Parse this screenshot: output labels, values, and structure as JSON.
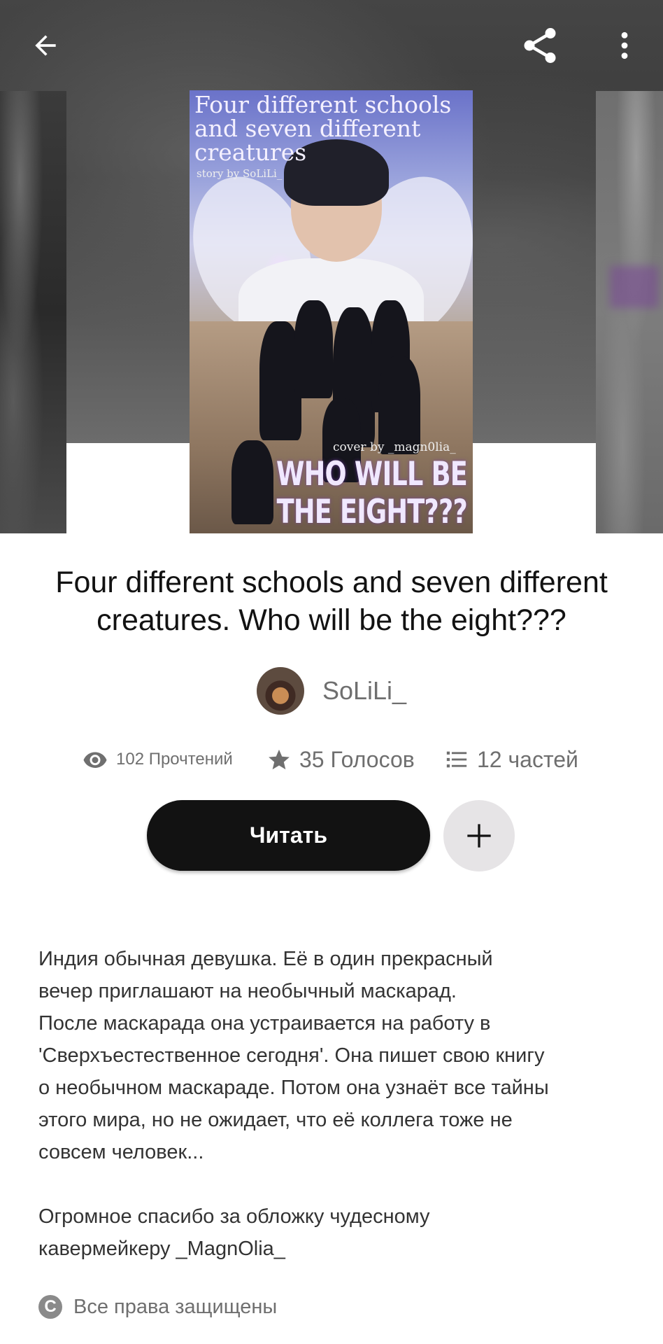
{
  "topbar": {
    "back_icon": "arrow-left-icon",
    "share_icon": "share-icon",
    "more_icon": "more-vertical-icon"
  },
  "cover": {
    "title_text": "Four different schools and seven different creatures",
    "story_by": "story by SoLiLi_",
    "cover_credit": "cover by _magn0lia_",
    "tagline": "WHO WILL BE THE EIGHT???"
  },
  "story": {
    "title": "Four different schools and seven different creatures. Who will be the eight???",
    "author": "SoLiLi_"
  },
  "stats": {
    "reads": "102 Прочтений",
    "votes": "35 Голосов",
    "parts": "12 частей"
  },
  "actions": {
    "read_label": "Читать",
    "add_icon": "plus-icon"
  },
  "description": "Индия обычная девушка. Её в один прекрасный\nвечер приглашают на необычный маскарад.\nПосле маскарада она устраивается на работу в\n'Сверхъестественное сегодня'. Она пишет свою книгу\nо необычном маскараде. Потом она узнаёт все тайны\nэтого мира, но не ожидает, что её коллега тоже не\nсовсем человек...\n\nОгромное спасибо за обложку чудесному\nкавермейкеру _MagnOlia_",
  "copyright": {
    "icon_letter": "C",
    "text": "Все права защищены"
  }
}
